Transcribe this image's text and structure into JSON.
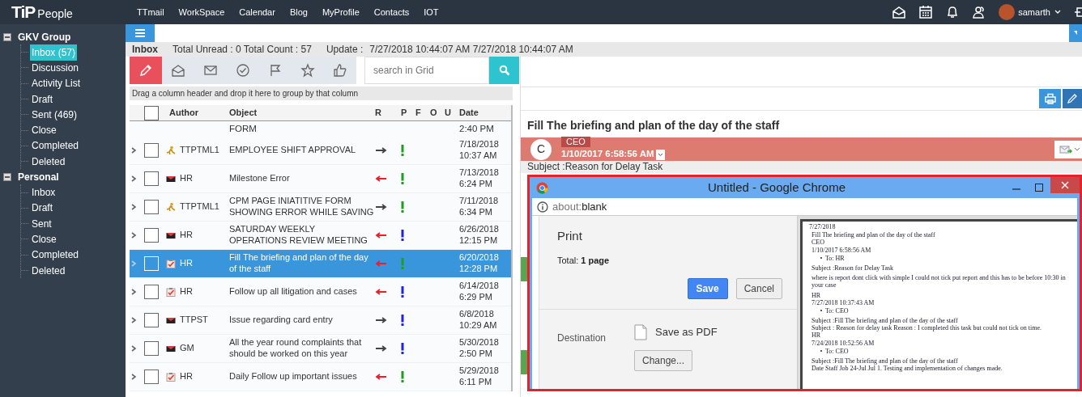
{
  "topbar": {
    "logo": {
      "mark": "TiP",
      "text": "People"
    },
    "links": [
      "TTmail",
      "WorkSpace",
      "Calendar",
      "Blog",
      "MyProfile",
      "Contacts",
      "IOT"
    ],
    "user": "samarth"
  },
  "sidebar": {
    "groups": [
      {
        "label": "GKV Group",
        "expanded": true,
        "items": [
          {
            "label": "Inbox (57)",
            "selected": true
          },
          {
            "label": "Discussion",
            "selected": false
          },
          {
            "label": "Activity List",
            "selected": false
          },
          {
            "label": "Draft",
            "selected": false
          },
          {
            "label": "Sent (469)",
            "selected": false
          },
          {
            "label": "Close",
            "selected": false
          },
          {
            "label": "Completed",
            "selected": false
          },
          {
            "label": "Deleted",
            "selected": false
          }
        ]
      },
      {
        "label": "Personal",
        "expanded": true,
        "items": [
          {
            "label": "Inbox",
            "selected": false
          },
          {
            "label": "Draft",
            "selected": false
          },
          {
            "label": "Sent",
            "selected": false
          },
          {
            "label": "Close",
            "selected": false
          },
          {
            "label": "Completed",
            "selected": false
          },
          {
            "label": "Deleted",
            "selected": false
          }
        ]
      }
    ]
  },
  "status": {
    "folder": "Inbox",
    "counts": "Total Unread : 0 Total Count : 57",
    "update_label": "Update :",
    "update_value": "7/27/2018 10:44:07 AM 7/27/2018 10:44:07 AM"
  },
  "search": {
    "placeholder": "search in Grid"
  },
  "grid": {
    "group_hint": "Drag a column header and drop it here to group by that column",
    "columns": [
      "Author",
      "Object",
      "R",
      "P",
      "F",
      "O",
      "U",
      "Date"
    ],
    "all_checked": false,
    "cut_row": {
      "object": "FORM",
      "date": "2:40 PM"
    },
    "rows": [
      {
        "kind": "task",
        "author": "TTPTML1",
        "object": "EMPLOYEE SHIFT APPROVAL",
        "arrow": {
          "kind": "right"
        },
        "priority": {
          "color": "#1e9e1e"
        },
        "date": "7/18/2018 10:37 AM",
        "selected": false,
        "checked": false
      },
      {
        "kind": "mail",
        "author": "HR",
        "object": "Milestone Error",
        "arrow": {
          "kind": "left"
        },
        "priority": {
          "color": "#1e9e1e"
        },
        "date": "7/13/2018 6:24 PM",
        "selected": false,
        "checked": false
      },
      {
        "kind": "task",
        "author": "TTPTML1",
        "object": "CPM PAGE INIATITIVE FORM SHOWING ERROR WHILE SAVING",
        "arrow": {
          "kind": "right"
        },
        "priority": {
          "color": "#1e9e1e"
        },
        "date": "7/11/2018 6:34 PM",
        "selected": false,
        "checked": false
      },
      {
        "kind": "mail",
        "author": "HR",
        "object": "SATURDAY WEEKLY OPERATIONS REVIEW MEETING",
        "arrow": {
          "kind": "left"
        },
        "priority": {
          "color": "#2222dd"
        },
        "date": "6/26/2018 12:15 PM",
        "selected": false,
        "checked": false
      },
      {
        "kind": "checklist",
        "author": "HR",
        "object": "Fill The briefing and plan of the day of the staff",
        "arrow": {
          "kind": "left"
        },
        "priority": {
          "color": "#1e9e1e"
        },
        "date": "6/20/2018 12:28 PM",
        "selected": true,
        "checked": false
      },
      {
        "kind": "checklist",
        "author": "HR",
        "object": "Follow up all litigation and cases",
        "arrow": {
          "kind": "left"
        },
        "priority": {
          "color": "#2222dd"
        },
        "date": "6/14/2018 6:29 PM",
        "selected": false,
        "checked": false
      },
      {
        "kind": "mail",
        "author": "TTPST",
        "object": "Issue regarding card entry",
        "arrow": {
          "kind": "right"
        },
        "priority": {
          "color": "#2222dd"
        },
        "date": "6/8/2018 10:29 AM",
        "selected": false,
        "checked": false
      },
      {
        "kind": "mail",
        "author": "GM",
        "object": "All the year round complaints that should be worked on this year",
        "arrow": {
          "kind": "right"
        },
        "priority": {
          "color": "#2222dd"
        },
        "date": "5/30/2018 2:50 PM",
        "selected": false,
        "checked": false
      },
      {
        "kind": "checklist",
        "author": "HR",
        "object": "Daily Follow up important issues",
        "arrow": {
          "kind": "left"
        },
        "priority": {
          "color": "#1e9e1e"
        },
        "date": "5/29/2018 6:11 PM",
        "selected": false,
        "checked": false
      }
    ]
  },
  "reading": {
    "title": "Fill The briefing and plan of the day of the staff",
    "sender_initial": "C",
    "sender": "CEO",
    "sent": "1/10/2017 6:58:56 AM",
    "subject": "Subject :Reason for Delay Task"
  },
  "popup": {
    "title": "Untitled - Google Chrome",
    "address": {
      "scheme": "about:",
      "path": "blank"
    },
    "print": {
      "heading": "Print",
      "total": "Total: **1 page**",
      "save": "Save",
      "cancel": "Cancel",
      "destination_label": "Destination",
      "destination": "Save as PDF",
      "change": "Change..."
    },
    "preview": {
      "lines": [
        {
          "kind": "tiny",
          "text": "7/27/2018"
        },
        {
          "kind": "line",
          "text": "Fill The briefing and plan of the day of the staff"
        },
        {
          "kind": "line",
          "text": "CEO"
        },
        {
          "kind": "line",
          "text": "1/10/2017 6:58:56 AM"
        },
        {
          "kind": "bullet",
          "text": "To: HR"
        },
        {
          "kind": "para",
          "text": "Subject :Reason for Delay Task"
        },
        {
          "kind": "para",
          "text": "where is report dont click with simple I could not tick put report and this has to be before 10:30 in your case"
        },
        {
          "kind": "para",
          "text": "HR"
        },
        {
          "kind": "line",
          "text": "7/27/2018 10:37:43 AM"
        },
        {
          "kind": "bullet",
          "text": "To: CEO"
        },
        {
          "kind": "para",
          "text": "Subject :Fill The briefing and plan of the day of the staff"
        },
        {
          "kind": "line",
          "text": "Subject : Reason for delay task Reason : I completed this task but could not tick on time."
        },
        {
          "kind": "line",
          "text": "HR"
        },
        {
          "kind": "line",
          "text": "7/24/2018 10:52:56 AM"
        },
        {
          "kind": "bullet",
          "text": "To: CEO"
        },
        {
          "kind": "para",
          "text": "Subject :Fill The briefing and plan of the day of the staff"
        },
        {
          "kind": "line",
          "text": "Date Staff Job 24-Jul Jul 1. Testing and implementation of changes made."
        }
      ]
    }
  }
}
